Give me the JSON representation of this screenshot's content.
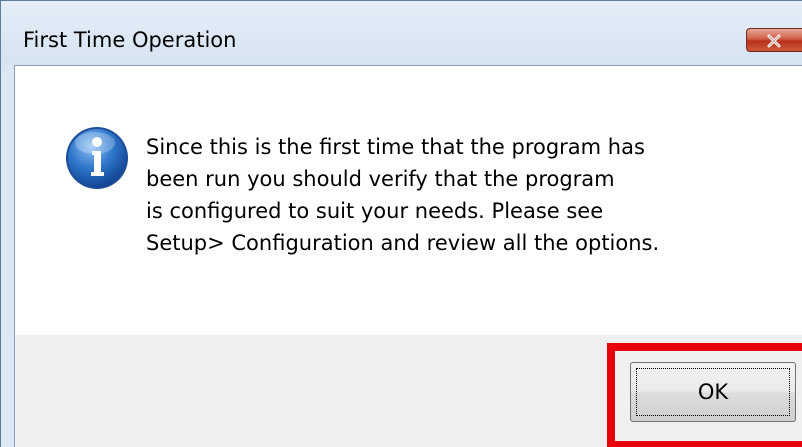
{
  "dialog": {
    "title": "First Time Operation",
    "close_icon": "close-icon",
    "message_icon": "info-icon",
    "message_lines": [
      "Since this is the first time that the program has",
      "been run you should verify that the program",
      "is configured to suit your needs.  Please see",
      "Setup> Configuration and review all the options."
    ],
    "ok_label": "OK"
  },
  "colors": {
    "highlight": "#e8000a",
    "info_blue": "#1f5fb4",
    "close_red": "#c23a23",
    "title_bg": "#dbe7f3"
  }
}
